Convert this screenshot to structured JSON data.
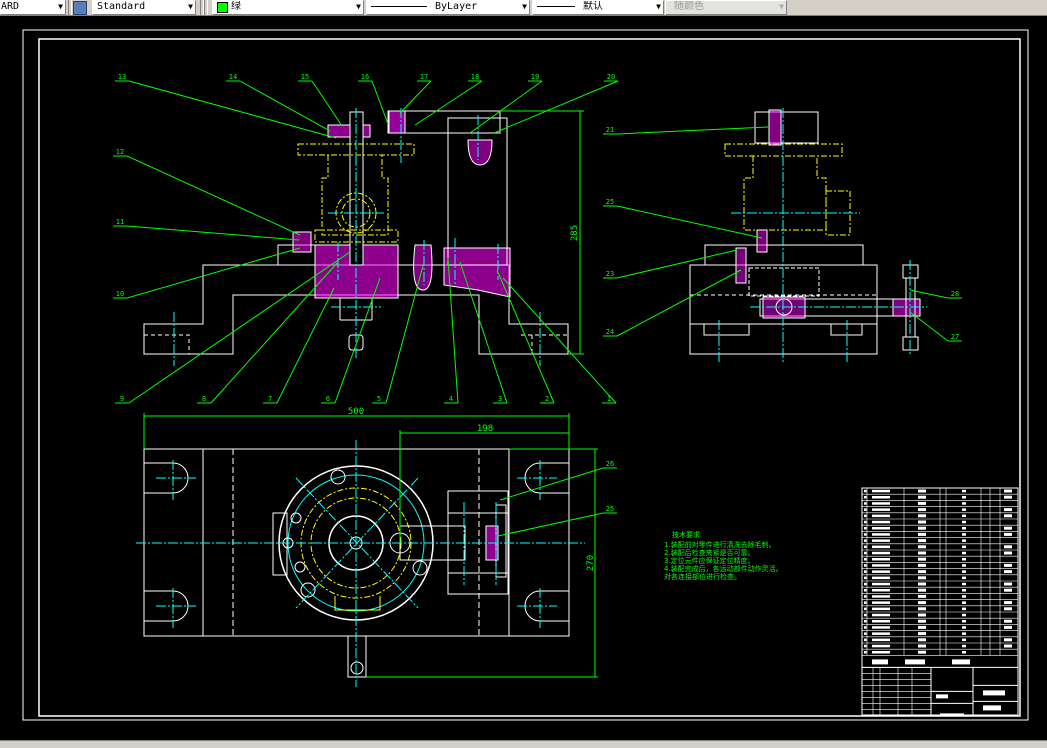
{
  "toolbar": {
    "text_style": "ARD",
    "dim_style": "Standard",
    "layer_color_label": "绿",
    "layer_color": "#00ff00",
    "linetype": "ByLayer",
    "lineweight": "默认",
    "plot_style": "随颜色"
  },
  "drawing": {
    "colors": {
      "outline": "#ffffff",
      "center": "#00ffff",
      "leader": "#00ff00",
      "hatch": "#ff00ff",
      "phantom": "#ffff00"
    },
    "front_view_balloons": {
      "top": [
        "13",
        "14",
        "15",
        "16",
        "17",
        "18",
        "19",
        "20"
      ],
      "left": [
        "12",
        "11",
        "10"
      ],
      "bottom": [
        "9",
        "8",
        "7",
        "6",
        "5",
        "4",
        "3",
        "2",
        "1"
      ]
    },
    "side_view_balloons": {
      "left": [
        "21",
        "25",
        "23",
        "24"
      ],
      "right": [
        "28",
        "27"
      ]
    },
    "top_view_balloons": [
      "26",
      "25"
    ],
    "dimensions": {
      "height": "285",
      "overall_length": "500",
      "offset": "198",
      "width": "270"
    },
    "technical_requirements": {
      "title": "技术要求",
      "lines": [
        "1.装配前对零件进行清洗去除毛刺。",
        "2.装配后检查夹紧是否可靠。",
        "3.定位元件应保证定位精度。",
        "4.装配完成后，各运动部件动作灵活。",
        "对各连接部位进行检查。"
      ]
    }
  }
}
